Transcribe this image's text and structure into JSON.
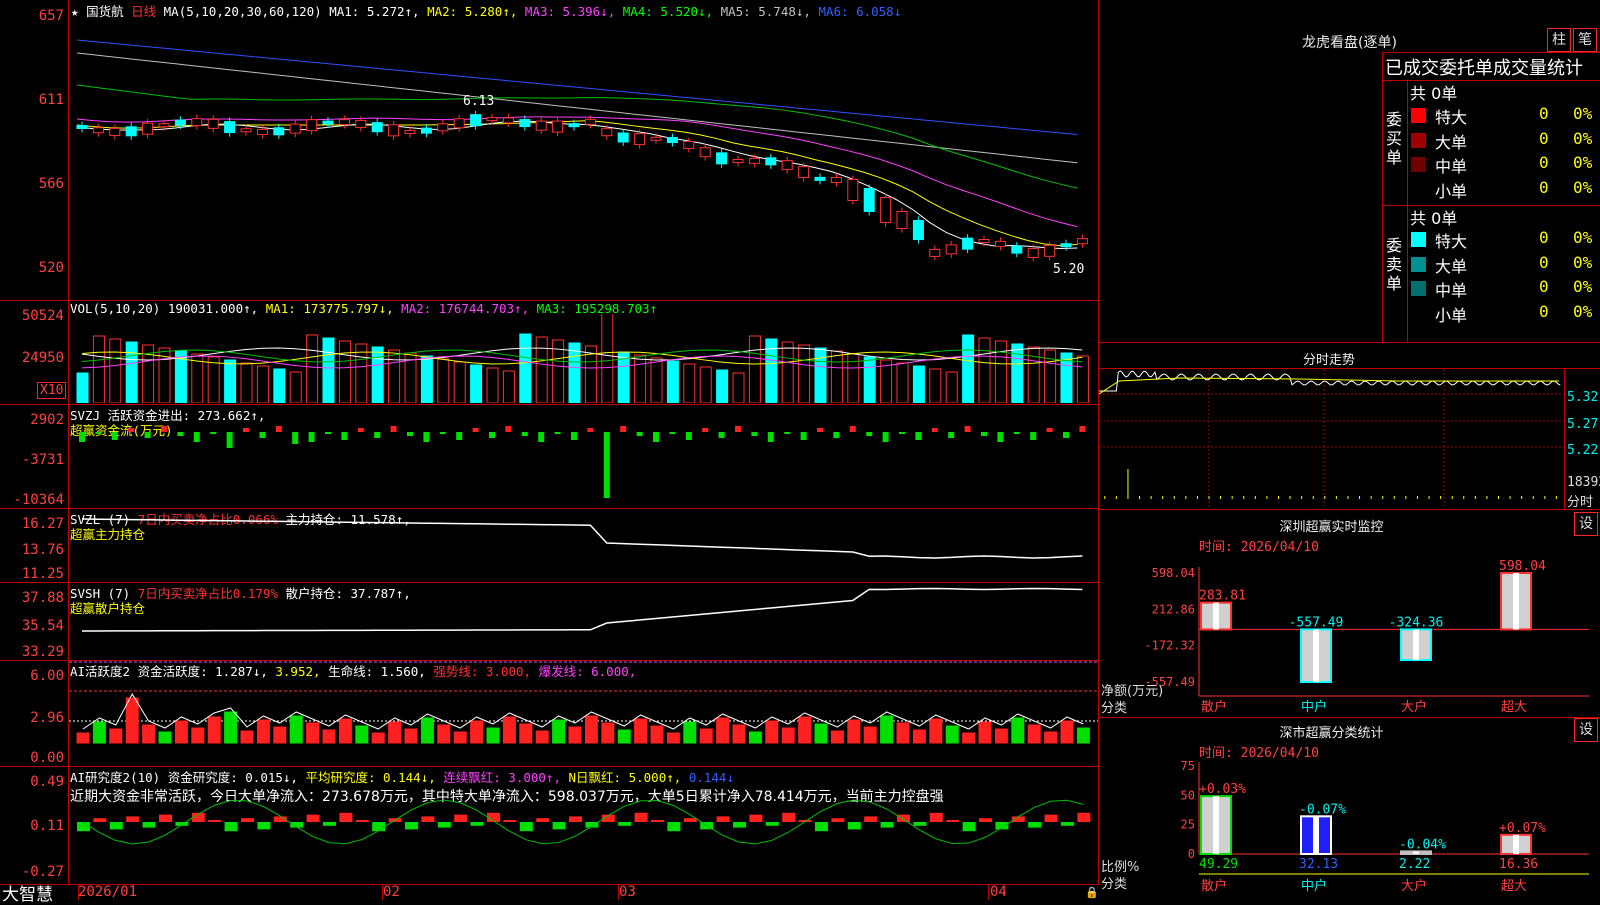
{
  "main": {
    "price_axis": [
      "657",
      "611",
      "566",
      "520"
    ],
    "title": {
      "star": "★",
      "stock": "国货航",
      "period": "日线",
      "ma_label": "MA(5,10,20,30,60,120)",
      "ma1": "MA1: 5.272↑,",
      "ma2": "MA2: 5.280↑,",
      "ma3": "MA3: 5.396↓,",
      "ma4": "MA4: 5.520↓,",
      "ma5": "MA5: 5.748↓,",
      "ma6": "MA6: 6.058↓"
    },
    "annot_high": "6.13",
    "annot_low": "5.20"
  },
  "vol": {
    "axis": [
      "50524",
      "24950"
    ],
    "unit": "X10",
    "title": {
      "label": "VOL(5,10,20)",
      "val": "190031.000↑,",
      "ma1": "MA1: 173775.797↓,",
      "ma2": "MA2: 176744.703↑,",
      "ma3": "MA3: 195298.703↑"
    }
  },
  "svzj": {
    "axis": [
      "2902",
      "-3731",
      "-10364"
    ],
    "title1": "SVZJ  活跃资金进出: 273.662↑,",
    "title2": "超赢资金流(万元)"
  },
  "svzl": {
    "axis": [
      "16.27",
      "13.76",
      "11.25"
    ],
    "title_a": "SVZL (7)",
    "title_b": "7日内买卖净占比0.066%",
    "title_c": "主力持仓: 11.578↑,",
    "title2": "超赢主力持仓"
  },
  "svsh": {
    "axis": [
      "37.88",
      "35.54",
      "33.29"
    ],
    "title_a": "SVSH (7)",
    "title_b": "7日内买卖净占比0.179%",
    "title_c": "散户持仓: 37.787↑,",
    "title2": "超赢散户持仓"
  },
  "ai1": {
    "axis": [
      "6.00",
      "2.96",
      "0.00"
    ],
    "title_a": "AI活跃度2",
    "title_b": "资金活跃度: 1.287↓,",
    "title_c": "3.952,",
    "title_d": "生命线: 1.560,",
    "title_e": "强势线: 3.000,",
    "title_f": "爆发线: 6.000,"
  },
  "ai2": {
    "axis": [
      "0.49",
      "0.11",
      "-0.27"
    ],
    "title_a": "AI研究度2(10)",
    "title_b": "资金研究度: 0.015↓,",
    "title_c": "平均研究度: 0.144↓,",
    "title_d": "连续飘红: 3.000↑,",
    "title_e": "N日飘红: 5.000↑,",
    "title_f": "0.144↓",
    "summary": "近期大资金非常活跃，今日大单净流入：273.678万元，其中特大单净流入：598.037万元，大单5日累计净入78.414万元，当前主力控盘强"
  },
  "bottom": {
    "brand": "大智慧",
    "dates": [
      "2026/01",
      "02",
      "03",
      "04"
    ]
  },
  "longhu": {
    "title": "龙虎看盘(逐单)",
    "btn_zhu": "柱",
    "btn_bi": "笔",
    "subtitle": "已成交委托单成交量统计",
    "buy_label": "委买单",
    "sell_label": "委卖单",
    "buy_total": "共 0单",
    "sell_total": "共 0单",
    "buy_rows": [
      {
        "name": "特大",
        "count": "0",
        "pct": "0%",
        "color": "#ff0000"
      },
      {
        "name": "大单",
        "count": "0",
        "pct": "0%",
        "color": "#a00000"
      },
      {
        "name": "中单",
        "count": "0",
        "pct": "0%",
        "color": "#700000"
      },
      {
        "name": "小单",
        "count": "0",
        "pct": "0%",
        "color": ""
      }
    ],
    "sell_rows": [
      {
        "name": "特大",
        "count": "0",
        "pct": "0%",
        "color": "#00ffff"
      },
      {
        "name": "大单",
        "count": "0",
        "pct": "0%",
        "color": "#009090"
      },
      {
        "name": "中单",
        "count": "0",
        "pct": "0%",
        "color": "#007070"
      },
      {
        "name": "小单",
        "count": "0",
        "pct": "0%",
        "color": ""
      }
    ]
  },
  "fenshi": {
    "title": "分时走势",
    "axis": [
      "5.32",
      "5.27",
      "5.22",
      "18392"
    ],
    "unit": "分时"
  },
  "monitor": {
    "title": "深圳超赢实时监控",
    "btn": "设",
    "time": "时间: 2026/04/10",
    "axis": [
      "598.04",
      "212.86",
      "-172.32",
      "-557.49"
    ],
    "axis_unit": "净额(万元)",
    "cat_label": "分类",
    "chart_data": {
      "type": "bar",
      "categories": [
        "散户",
        "中户",
        "大户",
        "超大"
      ],
      "values": [
        283.81,
        -557.49,
        -324.36,
        598.04
      ],
      "labels": [
        "283.81",
        "-557.49",
        "-324.36",
        "598.04"
      ],
      "ylim": [
        -557.49,
        598.04
      ]
    }
  },
  "classify": {
    "title": "深市超赢分类统计",
    "btn": "设",
    "time": "时间: 2026/04/10",
    "axis": [
      "75",
      "50",
      "25",
      "0"
    ],
    "axis_unit": "比例%",
    "cat_label": "分类",
    "chart_data": {
      "type": "bar",
      "categories": [
        "散户",
        "中户",
        "大户",
        "超大"
      ],
      "values": [
        49.29,
        32.13,
        2.22,
        16.36
      ],
      "values_text": [
        "49.29",
        "32.13",
        "2.22",
        "16.36"
      ],
      "changes": [
        "+0.03%",
        "-0.07%",
        "-0.04%",
        "+0.07%"
      ],
      "ylim": [
        0,
        75
      ]
    }
  }
}
